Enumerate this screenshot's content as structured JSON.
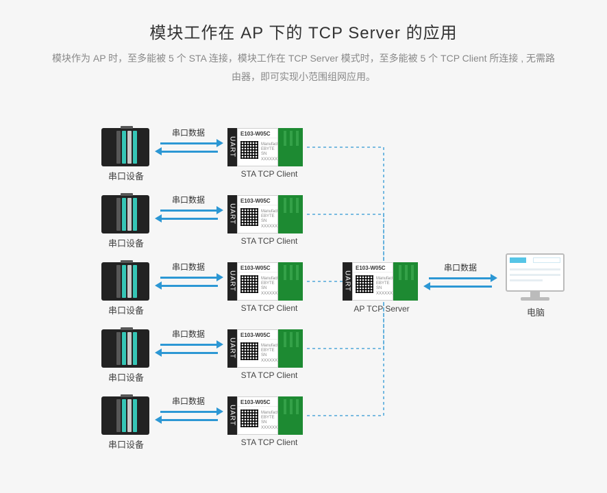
{
  "title": "模块工作在 AP 下的 TCP Server 的应用",
  "subtitle": "模块作为 AP 时，至多能被 5 个 STA 连接，模块工作在 TCP Server 模式时，至多能被 5 个 TCP Client 所连接 , 无需路由器，即可实现小范围组网应用。",
  "labels": {
    "serial_device": "串口设备",
    "sta_client": "STA  TCP  Client",
    "ap_server": "AP TCP Server",
    "pc": "电脑",
    "serial_data": "串口数据",
    "uart": "UART"
  },
  "module": {
    "model": "E103-W05C",
    "meta1": "Manufacturer  EBYTE",
    "meta2": "SN XXXXXXXXXX"
  },
  "rows": [
    0,
    1,
    2,
    3,
    4
  ]
}
